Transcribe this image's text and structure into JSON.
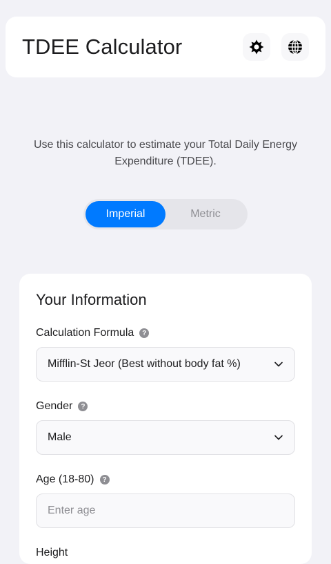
{
  "header": {
    "title": "TDEE Calculator",
    "theme_icon": "sun-icon",
    "language_icon": "globe-icon"
  },
  "intro": "Use this calculator to estimate your Total Daily Energy Expenditure (TDEE).",
  "units": {
    "options": [
      "Imperial",
      "Metric"
    ],
    "selected": "Imperial"
  },
  "form": {
    "title": "Your Information",
    "formula": {
      "label": "Calculation Formula",
      "value": "Mifflin-St Jeor (Best without body fat %)"
    },
    "gender": {
      "label": "Gender",
      "value": "Male"
    },
    "age": {
      "label": "Age (18-80)",
      "placeholder": "Enter age",
      "value": ""
    },
    "height": {
      "label": "Height"
    },
    "help_glyph": "?"
  },
  "colors": {
    "accent": "#007aff",
    "background": "#f2f2f7",
    "card": "#ffffff"
  }
}
